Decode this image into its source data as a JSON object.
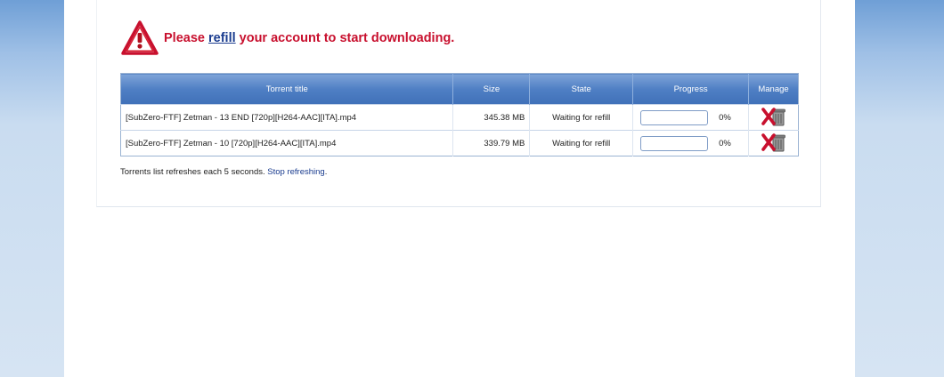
{
  "warning": {
    "prefix": "Please ",
    "link": "refill",
    "suffix": " your account to start downloading.",
    "color": "#c8102e"
  },
  "table": {
    "headers": {
      "title": "Torrent title",
      "size": "Size",
      "state": "State",
      "progress": "Progress",
      "manage": "Manage"
    },
    "rows": [
      {
        "title": "[SubZero-FTF] Zetman - 13 END [720p][H264-AAC][ITA].mp4",
        "size": "345.38 MB",
        "state": "Waiting for refill",
        "progress": 0,
        "progress_label": "0%",
        "manage_icon": "delete-icon"
      },
      {
        "title": "[SubZero-FTF] Zetman - 10 [720p][H264-AAC][ITA].mp4",
        "size": "339.79 MB",
        "state": "Waiting for refill",
        "progress": 0,
        "progress_label": "0%",
        "manage_icon": "delete-icon"
      }
    ]
  },
  "footer": {
    "text": "Torrents list refreshes each 5 seconds. ",
    "link": "Stop refreshing",
    "end": "."
  },
  "colors": {
    "header_blue": "#4f7fc4",
    "link_blue": "#1a3c8f",
    "warning_red": "#c8102e"
  }
}
